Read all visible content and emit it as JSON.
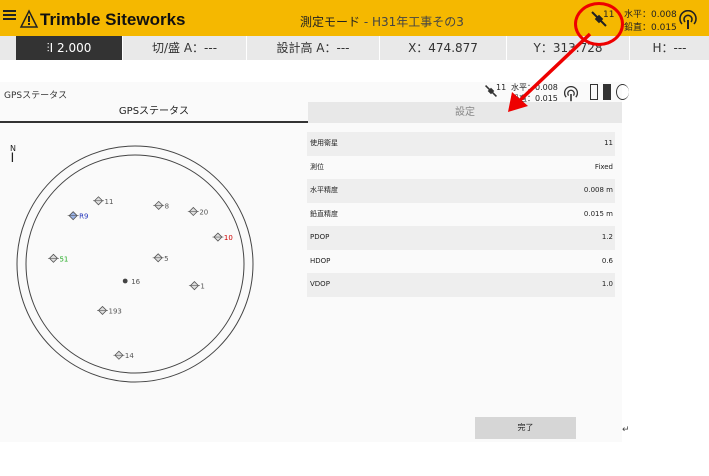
{
  "app": {
    "brand": "Trimble Siteworks",
    "mode_label": "測定モード",
    "mode_separator": " - ",
    "project_name": "H31年工事その3",
    "satellites": "11",
    "horizontal_precision": "水平：0.008",
    "vertical_precision": "鉛直：0.015"
  },
  "infobar": {
    "height": "2.000",
    "cut_fill": "切/盛 A：---",
    "design_height": "設計高 A：---",
    "x": "X：474.877",
    "y": "Y：313.728",
    "h": "H：---"
  },
  "screen": {
    "title": "GPSステータス",
    "satellites": "11",
    "horizontal_precision": "水平：0.008",
    "vertical_precision": "鉛直：0.015",
    "tabs": [
      "GPSステータス",
      "設定"
    ],
    "compass": "N",
    "done_label": "完了"
  },
  "skyplot": {
    "satellites": [
      {
        "id": "8",
        "az": 22,
        "el": 0.58,
        "color": "#555",
        "type": "sat"
      },
      {
        "id": "11",
        "az": -30,
        "el": 0.67,
        "color": "#555",
        "type": "sat"
      },
      {
        "id": "20",
        "az": 48,
        "el": 0.72,
        "color": "#555",
        "type": "sat"
      },
      {
        "id": "10",
        "az": 72,
        "el": 0.8,
        "color": "#c00",
        "type": "sat"
      },
      {
        "id": "R9",
        "az": -52,
        "el": 0.72,
        "color": "#2233bb",
        "type": "sat"
      },
      {
        "id": "5",
        "az": 75,
        "el": 0.22,
        "color": "#555",
        "type": "sat"
      },
      {
        "id": "51",
        "az": -86,
        "el": 0.75,
        "color": "#2a2",
        "type": "sat"
      },
      {
        "id": "1",
        "az": 110,
        "el": 0.58,
        "color": "#555",
        "type": "sat"
      },
      {
        "id": "16",
        "az": -150,
        "el": 0.18,
        "color": "#555",
        "type": "dot"
      },
      {
        "id": "193",
        "az": -145,
        "el": 0.52,
        "color": "#555",
        "type": "sat"
      },
      {
        "id": "14",
        "az": -170,
        "el": 0.85,
        "color": "#555",
        "type": "sat"
      }
    ]
  },
  "status": [
    {
      "label": "使用衛星",
      "value": "11"
    },
    {
      "label": "測位",
      "value": "Fixed"
    },
    {
      "label": "水平精度",
      "value": "0.008 m"
    },
    {
      "label": "鉛直精度",
      "value": "0.015 m"
    },
    {
      "label": "PDOP",
      "value": "1.2"
    },
    {
      "label": "HDOP",
      "value": "0.6"
    },
    {
      "label": "VDOP",
      "value": "1.0"
    }
  ],
  "annotation": {
    "color": "#e00000"
  }
}
